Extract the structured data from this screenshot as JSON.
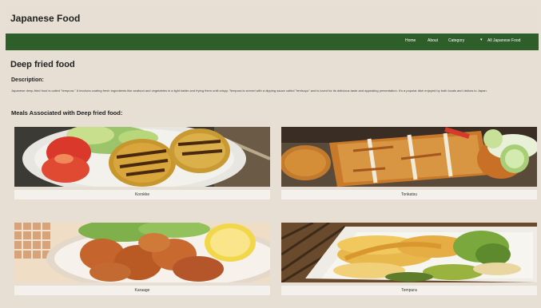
{
  "header": {
    "title": "Japanese Food"
  },
  "nav": {
    "home": "Home",
    "about": "About",
    "category": "Category",
    "all": "All Japanese Food"
  },
  "main": {
    "heading": "Deep fried food",
    "description_heading": "Description:",
    "description_text": "Japanese deep-fried food is called \"tempura.\" It involves coating fresh ingredients like seafood and vegetables in a light batter and frying them until crispy. Tempura is served with a dipping sauce called \"tentsuyu\" and is loved for its delicious taste and appealing presentation. It's a popular dish enjoyed by both locals and visitors to Japan.",
    "meals_heading": "Meals Associated with Deep fried food:",
    "meals": [
      {
        "name": "Korokke",
        "image": "korokke-photo"
      },
      {
        "name": "Tonkatsu",
        "image": "tonkatsu-photo"
      },
      {
        "name": "Karaage",
        "image": "karaage-photo"
      },
      {
        "name": "Tempura",
        "image": "tempura-photo"
      }
    ]
  },
  "colors": {
    "navbar": "#2e5e2a",
    "background": "#e7dfd4",
    "caption_bg": "#f4f1ec"
  }
}
